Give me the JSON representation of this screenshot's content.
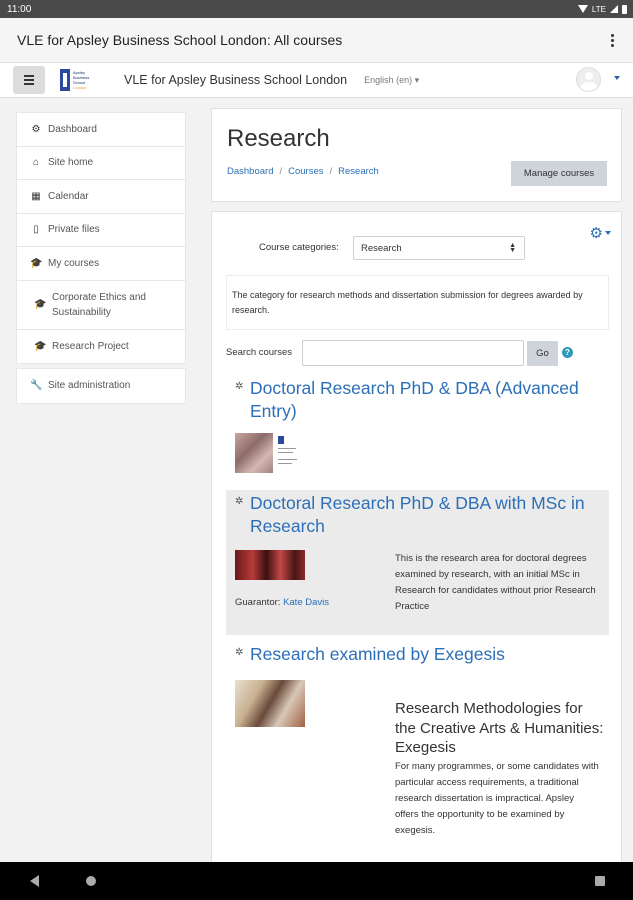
{
  "status_bar": {
    "time": "11:00",
    "network": "LTE"
  },
  "app_bar": {
    "title": "VLE for Apsley Business School London: All courses"
  },
  "navbar": {
    "site_name": "VLE for Apsley Business School London",
    "language": "English (en) ▾",
    "logo_lines": [
      "Apsley",
      "Business",
      "School",
      "London"
    ]
  },
  "sidebar": {
    "items": [
      {
        "label": "Dashboard",
        "icon": "dashboard-icon",
        "glyph": "⚙"
      },
      {
        "label": "Site home",
        "icon": "home-icon",
        "glyph": "⌂"
      },
      {
        "label": "Calendar",
        "icon": "calendar-icon",
        "glyph": "▦"
      },
      {
        "label": "Private files",
        "icon": "file-icon",
        "glyph": "▯"
      },
      {
        "label": "My courses",
        "icon": "graduation-cap-icon",
        "glyph": "🎓"
      },
      {
        "label": "Corporate Ethics and Sustainability",
        "icon": "graduation-cap-icon",
        "glyph": "🎓"
      },
      {
        "label": "Research Project",
        "icon": "graduation-cap-icon",
        "glyph": "🎓"
      }
    ],
    "admin": {
      "label": "Site administration",
      "icon": "wrench-icon",
      "glyph": "🔧"
    }
  },
  "header": {
    "title": "Research",
    "breadcrumb": [
      "Dashboard",
      "Courses",
      "Research"
    ],
    "manage_label": "Manage courses"
  },
  "category": {
    "label": "Course categories:",
    "selected": "Research",
    "description": "The category for research methods and dissertation submission for degrees awarded by research."
  },
  "search": {
    "label": "Search courses",
    "value": "",
    "placeholder": "",
    "go_label": "Go"
  },
  "courses": [
    {
      "title": "Doctoral Research PhD & DBA (Advanced Entry)"
    },
    {
      "title": "Doctoral Research PhD & DBA with MSc in Research",
      "guarantor_label": "Guarantor:",
      "guarantor_name": "Kate Davis",
      "summary": "This is the research area for doctoral degrees examined by research, with an initial MSc in Research for candidates without prior Research Practice"
    },
    {
      "title": "Research examined by Exegesis",
      "subheading": "Research Methodologies for the Creative Arts & Humanities: Exegesis",
      "summary": "For many programmes, or some candidates with particular access requirements, a traditional research dissertation is impractical. Apsley offers the opportunity to be examined by exegesis."
    }
  ],
  "colors": {
    "link": "#2c6fb8",
    "button": "#ced4da",
    "brand": "#2b4a9c"
  }
}
